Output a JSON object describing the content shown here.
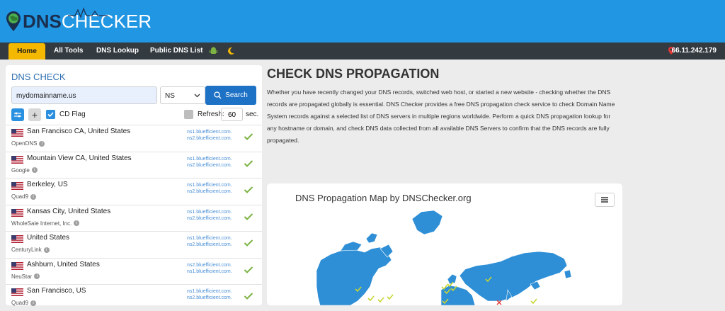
{
  "brand": {
    "logo_dns": "DNS",
    "logo_checker": "CHECKER"
  },
  "nav": {
    "items": [
      "Home",
      "All Tools",
      "DNS Lookup",
      "Public DNS List"
    ],
    "android_icon": "android-icon",
    "moon_icon": "moon-icon",
    "ip": "66.11.242.179",
    "location_icon": "map-marker-icon"
  },
  "dnscheck": {
    "title": "DNS CHECK",
    "domain": "mydomainname.us",
    "record_type": "NS",
    "search_label": "Search",
    "cd_flag_label": "CD Flag",
    "refresh_label": "Refresh:",
    "refresh_value": "60",
    "refresh_unit": "sec.",
    "results": [
      {
        "location": "San Francisco CA, United States",
        "provider": "OpenDNS",
        "ns1": "ns1.bluefficient.com.",
        "ns2": "ns2.bluefficient.com."
      },
      {
        "location": "Mountain View CA, United States",
        "provider": "Google",
        "ns1": "ns1.bluefficient.com.",
        "ns2": "ns2.bluefficient.com."
      },
      {
        "location": "Berkeley, US",
        "provider": "Quad9",
        "ns1": "ns1.bluefficient.com.",
        "ns2": "ns2.bluefficient.com."
      },
      {
        "location": "Kansas City, United States",
        "provider": "WholeSale Internet, Inc.",
        "ns1": "ns1.bluefficient.com.",
        "ns2": "ns2.bluefficient.com."
      },
      {
        "location": "United States",
        "provider": "CenturyLink",
        "ns1": "ns1.bluefficient.com.",
        "ns2": "ns2.bluefficient.com."
      },
      {
        "location": "Ashburn, United States",
        "provider": "NeuStar",
        "ns1": "ns2.bluefficient.com.",
        "ns2": "ns1.bluefficient.com."
      },
      {
        "location": "San Francisco, US",
        "provider": "Quad9",
        "ns1": "ns1.bluefficient.com.",
        "ns2": "ns2.bluefficient.com."
      }
    ]
  },
  "main": {
    "title": "CHECK DNS PROPAGATION",
    "description": "Whether you have recently changed your DNS records, switched web host, or started a new website - checking whether the DNS records are propagated globally is essential. DNS Checker provides a free DNS propagation check service to check Domain Name System records against a selected list of DNS servers in multiple regions worldwide. Perform a quick DNS propagation lookup for any hostname or domain, and check DNS data collected from all available DNS Servers to confirm that the DNS records are fully propagated.",
    "map_title": "DNS Propagation Map by DNSChecker.org"
  },
  "colors": {
    "brand_blue": "#2196e3",
    "nav_dark": "#333a40",
    "home_yellow": "#f5b800",
    "check_green": "#7cb342",
    "search_blue": "#1e72c6",
    "map_ocean": "#2e8fd6"
  }
}
